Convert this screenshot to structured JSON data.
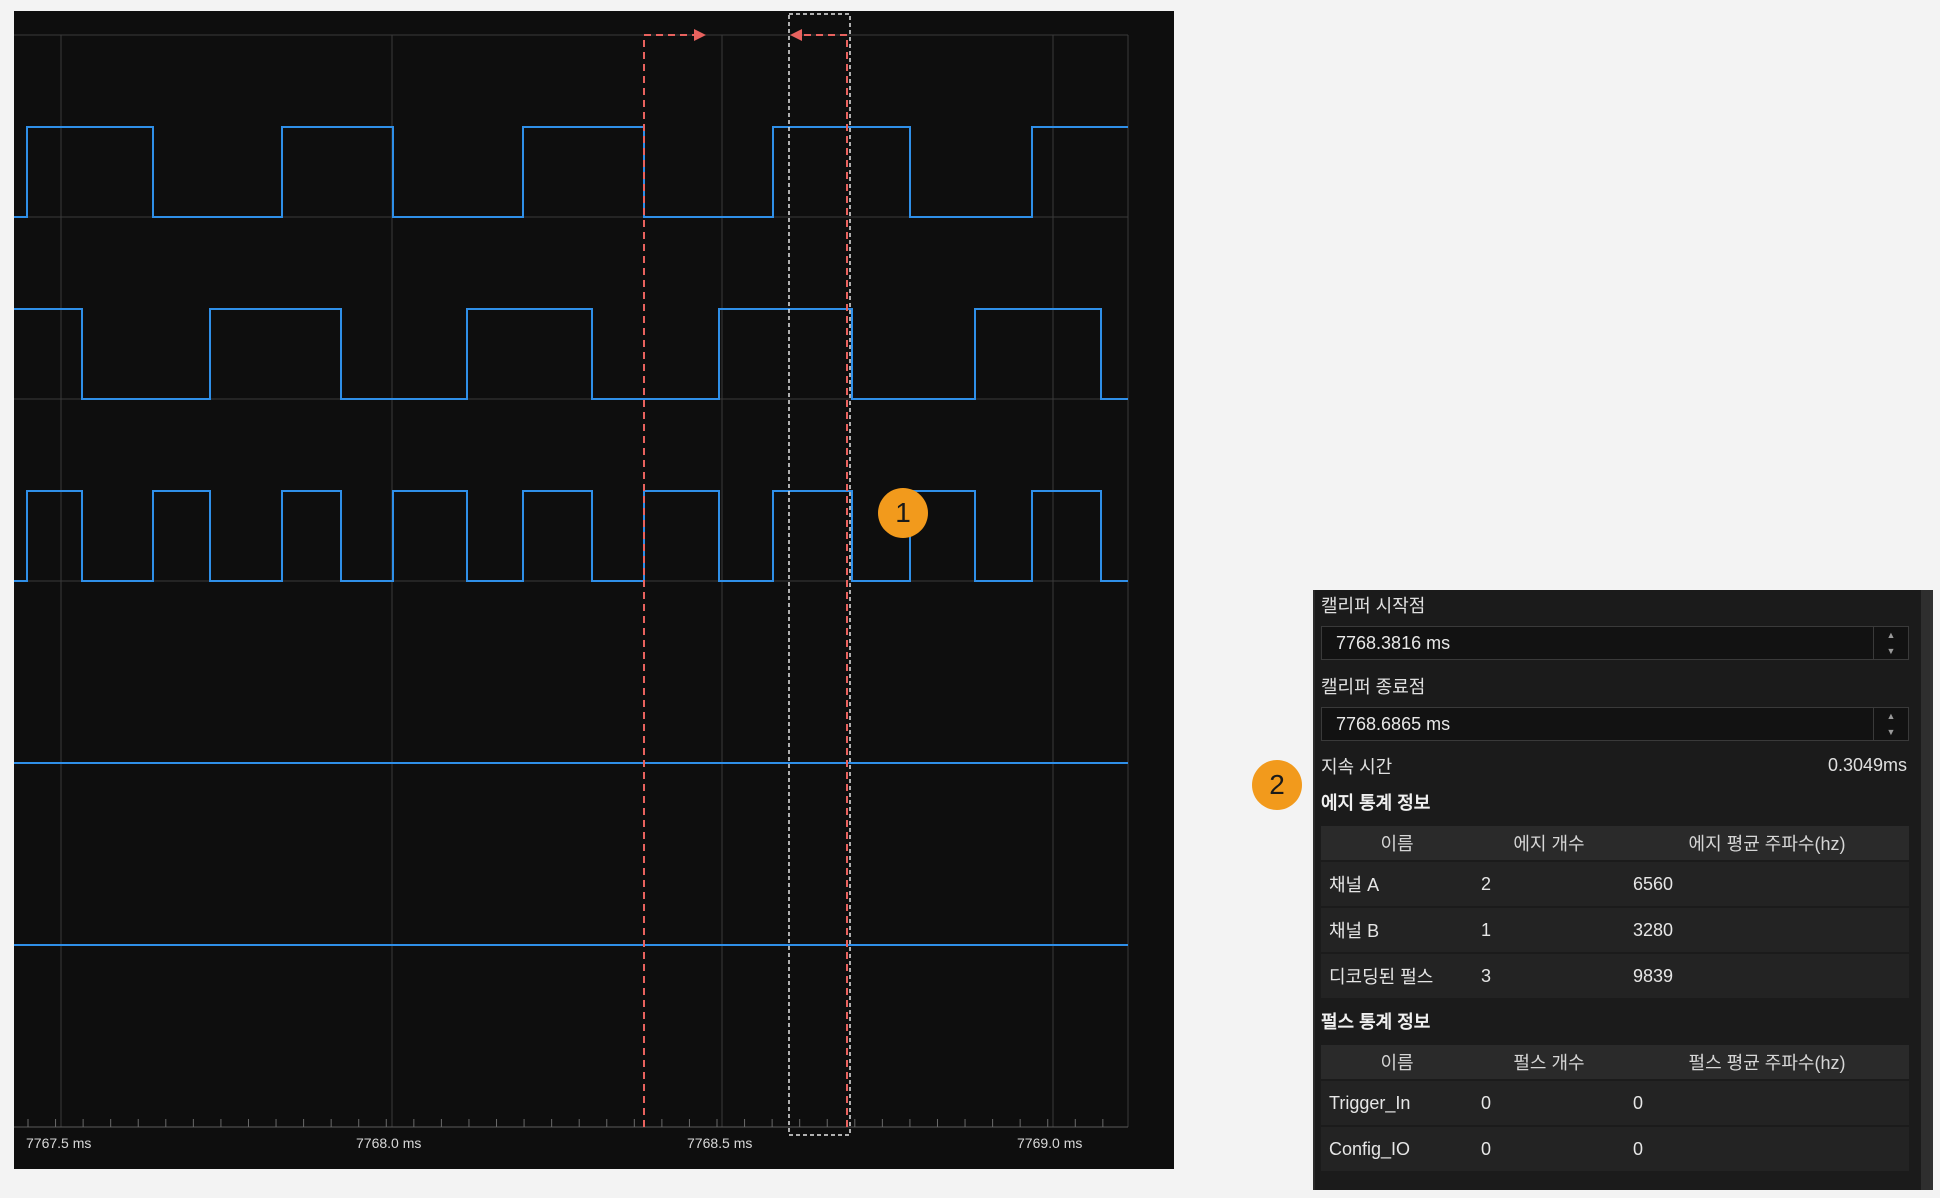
{
  "scope": {
    "background": "#0e0e0e",
    "signal_color": "#2f8fe8",
    "cursor_color": "#e8625e",
    "time_labels": [
      "7767.5 ms",
      "7768.0 ms",
      "7768.5 ms",
      "7769.0 ms"
    ]
  },
  "markers": [
    "1",
    "2"
  ],
  "panel": {
    "caliper_start_label": "캘리퍼 시작점",
    "caliper_start_value": "7768.3816 ms",
    "caliper_end_label": "캘리퍼 종료점",
    "caliper_end_value": "7768.6865 ms",
    "duration_label": "지속 시간",
    "duration_value": "0.3049ms",
    "edge_section_title": "에지 통계 정보",
    "edge_table": {
      "headers": [
        "이름",
        "에지 개수",
        "에지 평균 주파수(hz)"
      ],
      "rows": [
        [
          "채널 A",
          "2",
          "6560"
        ],
        [
          "채널 B",
          "1",
          "3280"
        ],
        [
          "디코딩된 펄스",
          "3",
          "9839"
        ]
      ]
    },
    "pulse_section_title": "펄스 통계 정보",
    "pulse_table": {
      "headers": [
        "이름",
        "펄스 개수",
        "펄스 평균 주파수(hz)"
      ],
      "rows": [
        [
          "Trigger_In",
          "0",
          "0"
        ],
        [
          "Config_IO",
          "0",
          "0"
        ]
      ]
    }
  }
}
